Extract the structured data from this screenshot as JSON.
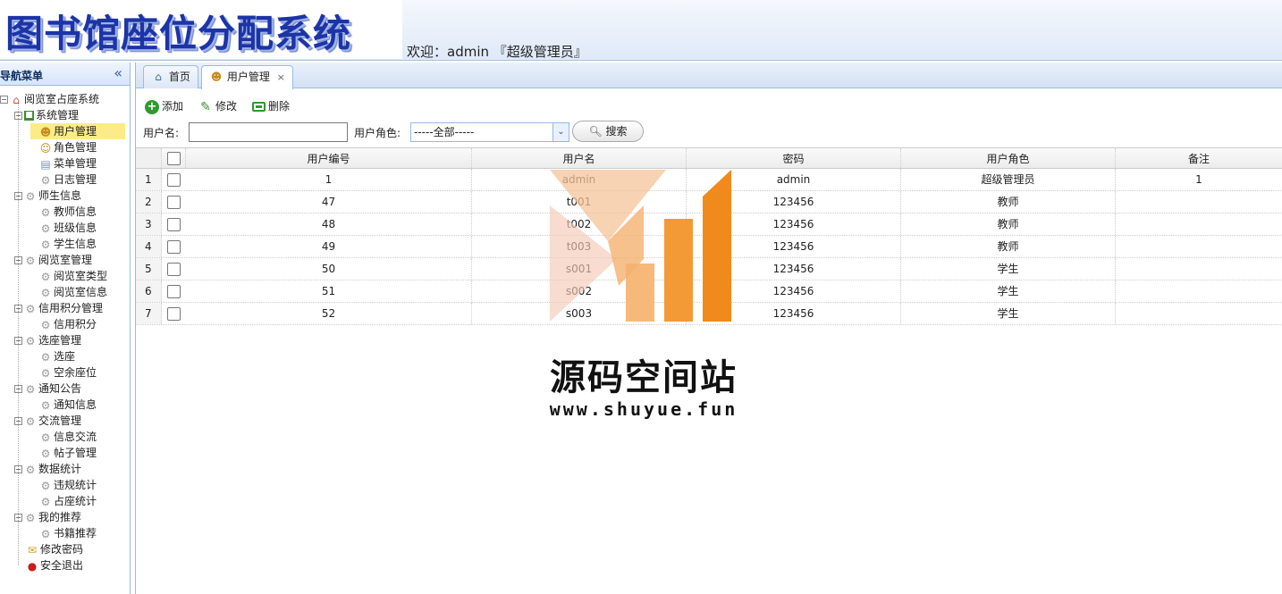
{
  "header": {
    "title": "图书馆座位分配系统",
    "welcome": "欢迎：admin 『超级管理员』"
  },
  "sidebar": {
    "title": "导航菜单",
    "tree": [
      {
        "label": "阅览室占座系统",
        "icon": "home-icon",
        "level": 0,
        "group": true
      },
      {
        "label": "系统管理",
        "icon": "system-icon",
        "level": 1,
        "group": true
      },
      {
        "label": "用户管理",
        "icon": "user-icon",
        "level": 2,
        "selected": true
      },
      {
        "label": "角色管理",
        "icon": "role-icon",
        "level": 2
      },
      {
        "label": "菜单管理",
        "icon": "menu-icon",
        "level": 2
      },
      {
        "label": "日志管理",
        "icon": "gear-icon",
        "level": 2
      },
      {
        "label": "师生信息",
        "icon": "gear-icon",
        "level": 1,
        "group": true
      },
      {
        "label": "教师信息",
        "icon": "gear-icon",
        "level": 2
      },
      {
        "label": "班级信息",
        "icon": "gear-icon",
        "level": 2
      },
      {
        "label": "学生信息",
        "icon": "gear-icon",
        "level": 2
      },
      {
        "label": "阅览室管理",
        "icon": "gear-icon",
        "level": 1,
        "group": true
      },
      {
        "label": "阅览室类型",
        "icon": "gear-icon",
        "level": 2
      },
      {
        "label": "阅览室信息",
        "icon": "gear-icon",
        "level": 2
      },
      {
        "label": "信用积分管理",
        "icon": "gear-icon",
        "level": 1,
        "group": true
      },
      {
        "label": "信用积分",
        "icon": "gear-icon",
        "level": 2
      },
      {
        "label": "选座管理",
        "icon": "gear-icon",
        "level": 1,
        "group": true
      },
      {
        "label": "选座",
        "icon": "gear-icon",
        "level": 2
      },
      {
        "label": "空余座位",
        "icon": "gear-icon",
        "level": 2
      },
      {
        "label": "通知公告",
        "icon": "gear-icon",
        "level": 1,
        "group": true
      },
      {
        "label": "通知信息",
        "icon": "gear-icon",
        "level": 2
      },
      {
        "label": "交流管理",
        "icon": "gear-icon",
        "level": 1,
        "group": true
      },
      {
        "label": "信息交流",
        "icon": "gear-icon",
        "level": 2
      },
      {
        "label": "帖子管理",
        "icon": "gear-icon",
        "level": 2
      },
      {
        "label": "数据统计",
        "icon": "gear-icon",
        "level": 1,
        "group": true
      },
      {
        "label": "违规统计",
        "icon": "gear-icon",
        "level": 2
      },
      {
        "label": "占座统计",
        "icon": "gear-icon",
        "level": 2
      },
      {
        "label": "我的推荐",
        "icon": "gear-icon",
        "level": 1,
        "group": true
      },
      {
        "label": "书籍推荐",
        "icon": "gear-icon",
        "level": 2
      },
      {
        "label": "修改密码",
        "icon": "lock-icon",
        "level": 1
      },
      {
        "label": "安全退出",
        "icon": "exit-icon",
        "level": 1
      }
    ]
  },
  "tabs": {
    "home": "首页",
    "user_management": "用户管理",
    "close": "×"
  },
  "toolbar": {
    "add": "添加",
    "edit": "修改",
    "delete": "删除",
    "username_label": "用户名:",
    "username_value": "",
    "role_label": "用户角色:",
    "role_selected": "-----全部-----",
    "search": "搜索"
  },
  "grid": {
    "columns": [
      "用户编号",
      "用户名",
      "密码",
      "用户角色",
      "备注"
    ],
    "rows": [
      {
        "n": "1",
        "id": "1",
        "name": "admin",
        "password": "admin",
        "role": "超级管理员",
        "note": "1"
      },
      {
        "n": "2",
        "id": "47",
        "name": "t001",
        "password": "123456",
        "role": "教师",
        "note": ""
      },
      {
        "n": "3",
        "id": "48",
        "name": "t002",
        "password": "123456",
        "role": "教师",
        "note": ""
      },
      {
        "n": "4",
        "id": "49",
        "name": "t003",
        "password": "123456",
        "role": "教师",
        "note": ""
      },
      {
        "n": "5",
        "id": "50",
        "name": "s001",
        "password": "123456",
        "role": "学生",
        "note": ""
      },
      {
        "n": "6",
        "id": "51",
        "name": "s002",
        "password": "123456",
        "role": "学生",
        "note": ""
      },
      {
        "n": "7",
        "id": "52",
        "name": "s003",
        "password": "123456",
        "role": "学生",
        "note": ""
      }
    ]
  },
  "watermark": {
    "title": "源码空间站",
    "url": "www.shuyue.fun"
  },
  "colors": {
    "accent": "#99bbe8",
    "logo": "#1c34a6",
    "selected": "#fbec88",
    "watermark_orange": "#f08a1c"
  }
}
